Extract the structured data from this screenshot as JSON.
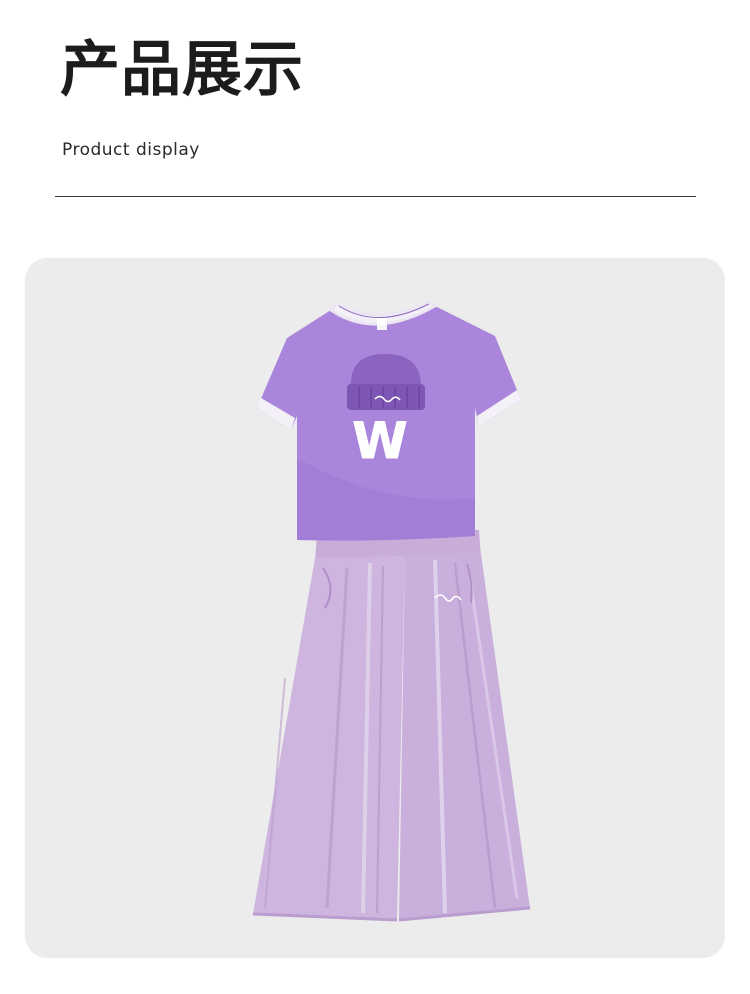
{
  "header": {
    "title": "产品展示",
    "subtitle": "Product display"
  },
  "product_image": {
    "description_icon": "tshirt-and-pants-icon",
    "shirt_graphic_letter": "W",
    "colors": {
      "panel_background": "#ececec",
      "shirt_purple": "#a985db",
      "shirt_trim": "#f3f0f7",
      "beanie_purple": "#8b63c0",
      "pants_lavender": "#cdb5df"
    }
  }
}
